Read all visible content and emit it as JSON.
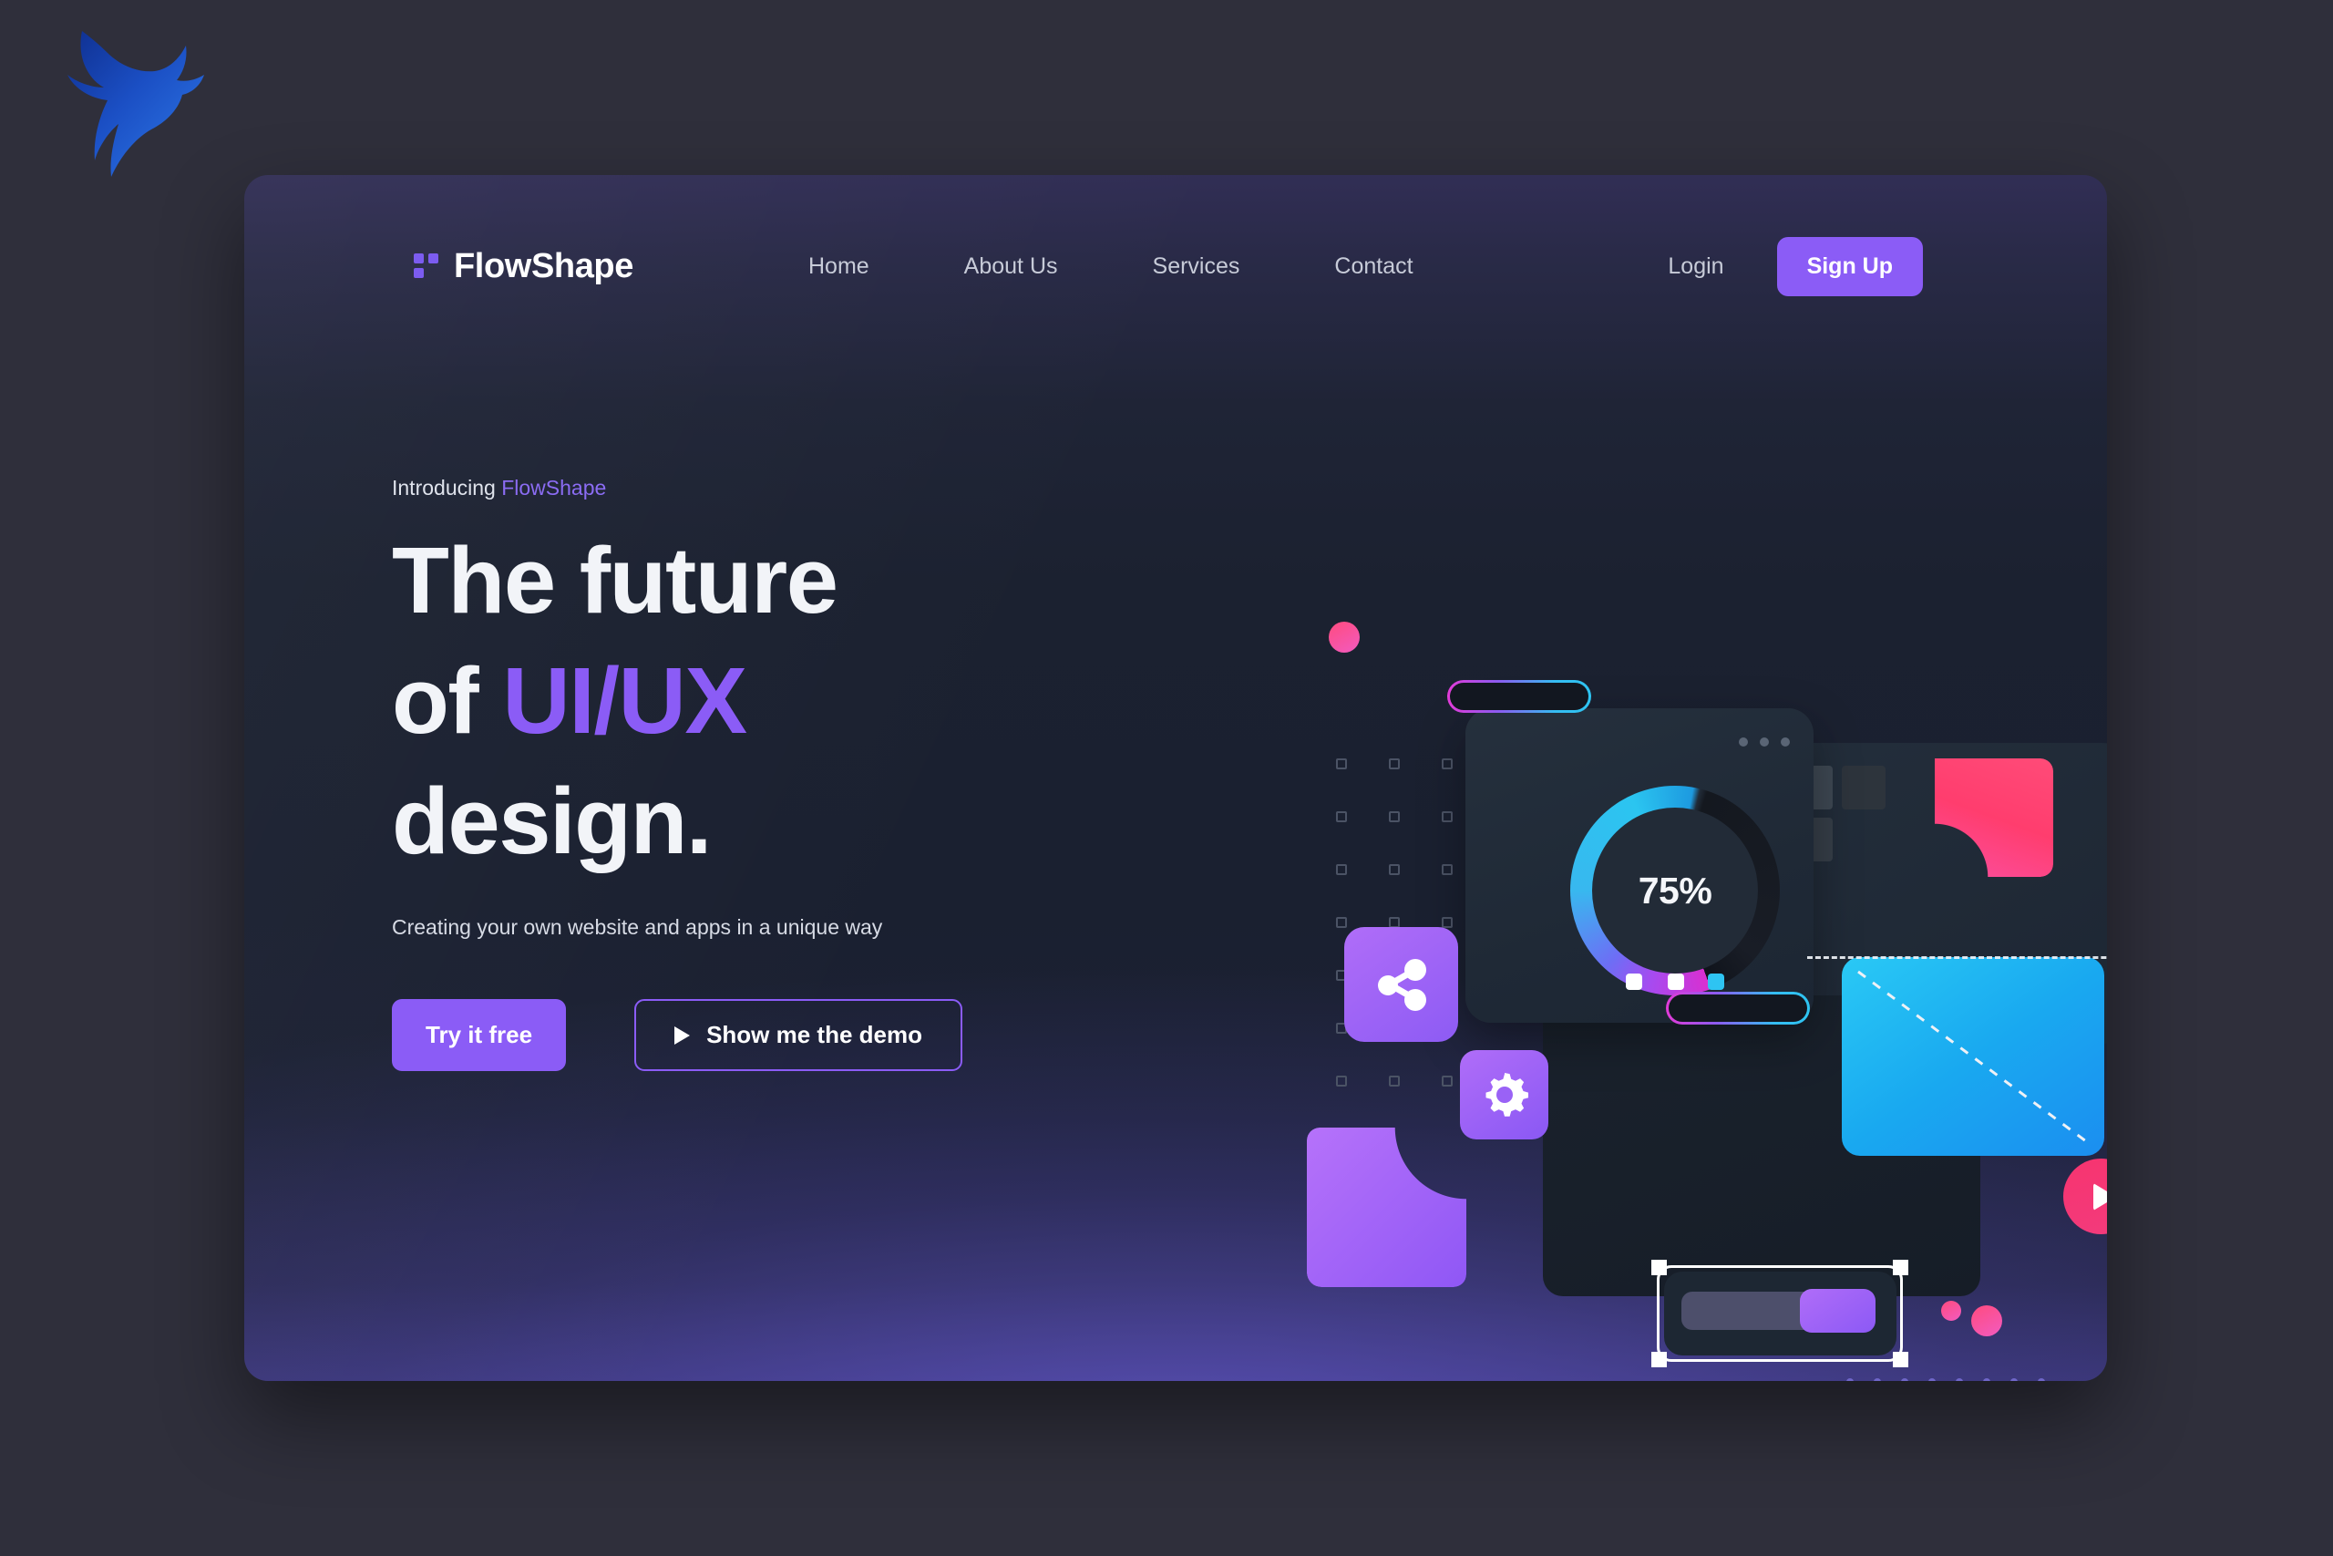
{
  "brand": {
    "name": "FlowShape",
    "logo_icon": "flowshape-squares-icon",
    "corner_logo_icon": "bull-head-logo-icon",
    "accent_color": "#8b5cf6"
  },
  "nav": {
    "links": [
      {
        "label": "Home"
      },
      {
        "label": "About Us"
      },
      {
        "label": "Services"
      },
      {
        "label": "Contact"
      }
    ],
    "login_label": "Login",
    "signup_label": "Sign Up"
  },
  "hero": {
    "eyebrow_prefix": "Introducing",
    "eyebrow_accent": "FlowShape",
    "headline_line1": "The future",
    "headline_line2_prefix": "of",
    "headline_line2_accent": "UI/UX",
    "headline_line3": "design.",
    "subcopy": "Creating your own website and apps in a unique way",
    "primary_cta": "Try it free",
    "secondary_cta": "Show me the demo",
    "secondary_cta_icon": "play-triangle-icon"
  },
  "illustration": {
    "progress_label": "75%",
    "progress_value": 75,
    "share_icon": "share-nodes-icon",
    "gear_icon": "gear-icon",
    "play_icon": "play-circle-icon",
    "window_dots_icon": "window-dots-icon",
    "slider_icon": "vertical-slider-icon",
    "selection_frame_icon": "selection-handles-icon",
    "chips": [
      {
        "color": "#ffffff"
      },
      {
        "color": "#ffffff"
      },
      {
        "color": "#2ec4f2"
      }
    ],
    "palette": {
      "purple": "#8b5cf6",
      "pink": "#ff3d6e",
      "cyan": "#2ac9f5",
      "magenta": "#e23bd8",
      "orange": "#ffa018",
      "red_marker": "#ec3f1c"
    }
  }
}
